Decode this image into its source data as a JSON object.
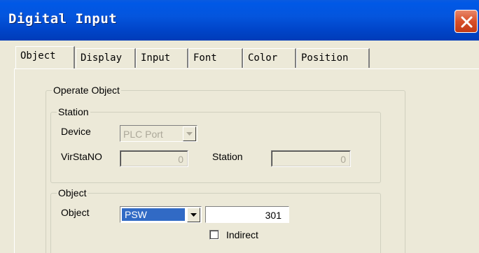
{
  "window": {
    "title": "Digital Input"
  },
  "tabs": [
    "Object",
    "Display",
    "Input",
    "Font",
    "Color",
    "Position"
  ],
  "operate_object": {
    "legend": "Operate Object",
    "station_group": {
      "legend": "Station",
      "device_label": "Device",
      "device_value": "PLC Port",
      "virstano_label": "VirStaNO",
      "virstano_value": "0",
      "station_label": "Station",
      "station_value": "0"
    },
    "object_group": {
      "legend": "Object",
      "object_label": "Object",
      "object_type": "PSW",
      "object_address": "301",
      "indirect_label": "Indirect",
      "indirect_checked": false
    }
  },
  "icons": {
    "close": "close-icon",
    "dropdown": "chevron-down-icon"
  },
  "colors": {
    "title_bar": "#0054e3",
    "dialog_bg": "#ece9d8",
    "selection": "#316ac5",
    "close_button": "#d8502a"
  }
}
